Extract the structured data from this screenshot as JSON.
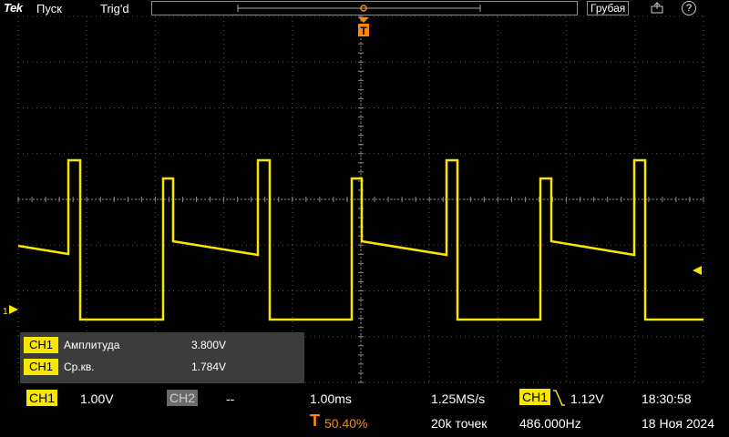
{
  "topbar": {
    "brand": "Tek",
    "run_state": "Пуск",
    "trigger_state": "Trig'd",
    "coarse_label": "Грубая",
    "help_label": "?"
  },
  "trigger_marker": "T",
  "ch1_marker": "1",
  "measurements": [
    {
      "channel": "CH1",
      "name": "Амплитуда",
      "value": "3.800V"
    },
    {
      "channel": "CH1",
      "name": "Ср.кв.",
      "value": "1.784V"
    }
  ],
  "status": {
    "ch1_label": "CH1",
    "ch1_scale": "1.00V",
    "ch2_label": "CH2",
    "ch2_scale": "--",
    "timebase": "1.00ms",
    "trigger_pos_icon": "T",
    "trigger_pos": "50.40%",
    "sample_rate": "1.25MS/s",
    "record_length": "20k точек",
    "trig_source": "CH1",
    "trig_level": "1.12V",
    "frequency": "486.000Hz",
    "time": "18:30:58",
    "date": "18 Ноя 2024"
  },
  "colors": {
    "ch1": "#f6e600",
    "grid": "#666666",
    "trigger": "#ff8a00",
    "background": "#000000"
  },
  "icons": [
    "save-icon",
    "help-icon",
    "trigger-falling-edge-icon",
    "trigger-position-icon"
  ]
}
